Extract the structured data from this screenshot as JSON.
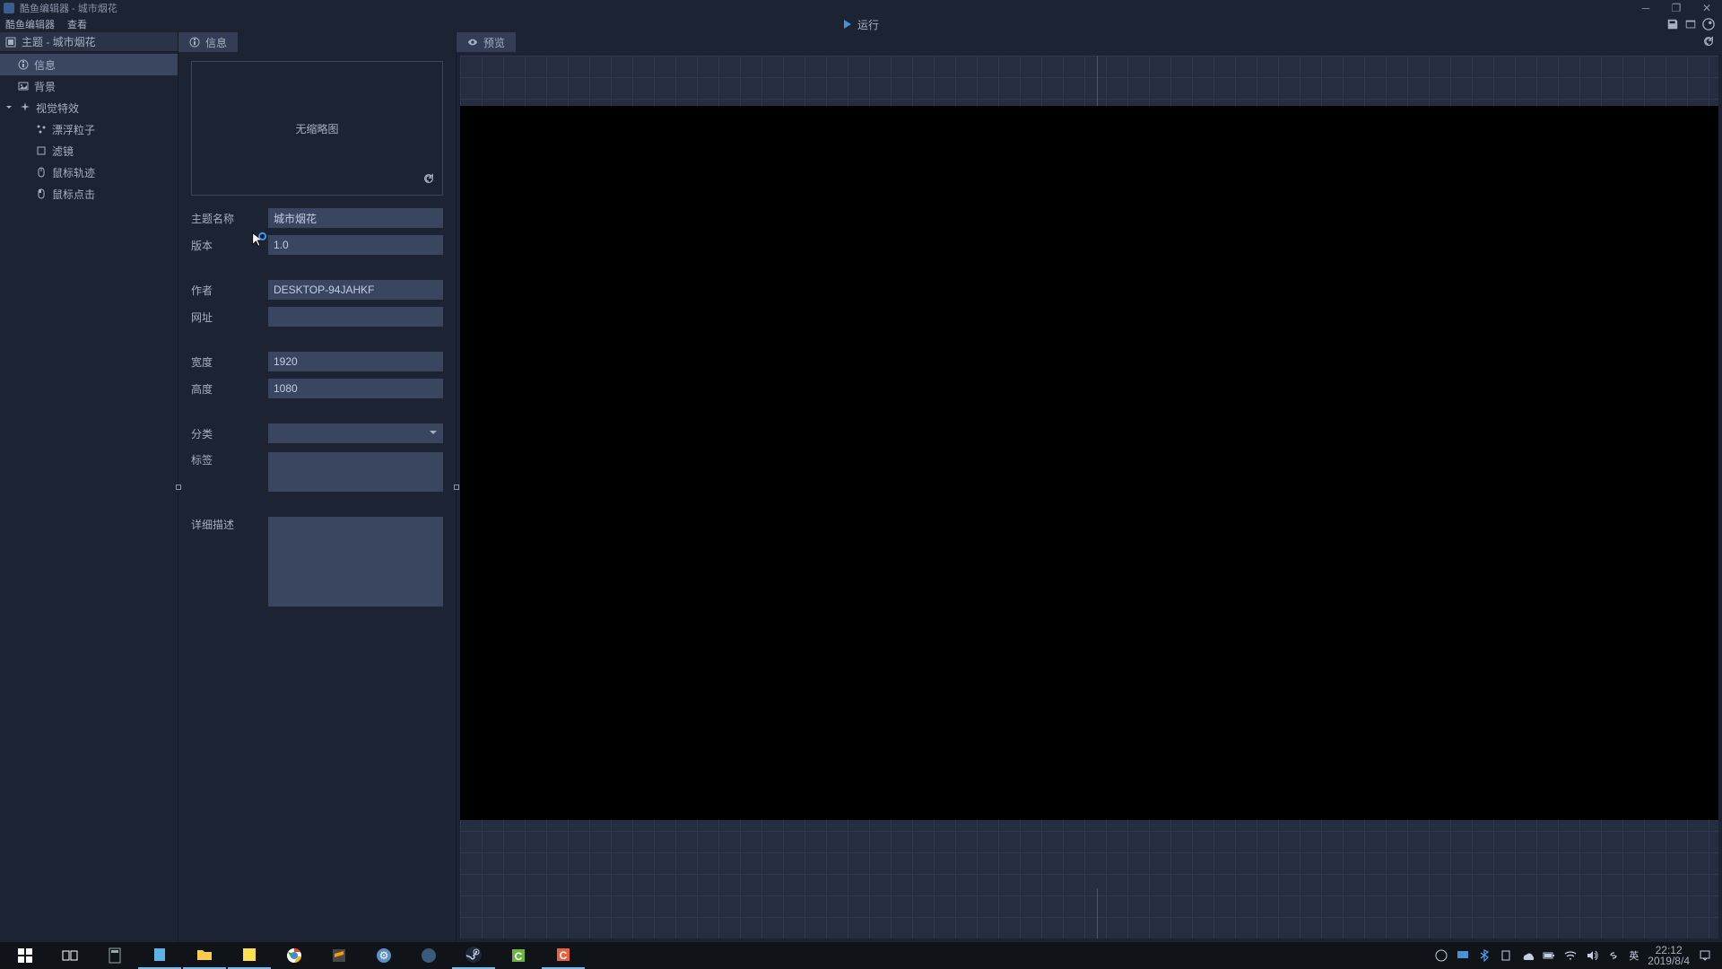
{
  "window": {
    "title": "酷鱼编辑器 - 城市烟花"
  },
  "menu": {
    "editor": "酷鱼编辑器",
    "view": "查看",
    "run": "运行"
  },
  "sidebar": {
    "header": "主题 - 城市烟花",
    "items": [
      {
        "label": "信息"
      },
      {
        "label": "背景"
      },
      {
        "label": "视觉特效"
      },
      {
        "label": "漂浮粒子"
      },
      {
        "label": "滤镜"
      },
      {
        "label": "鼠标轨迹"
      },
      {
        "label": "鼠标点击"
      }
    ]
  },
  "infoTab": {
    "label": "信息"
  },
  "previewTab": {
    "label": "预览"
  },
  "thumbnail": {
    "placeholder": "无缩略图"
  },
  "form": {
    "name_label": "主题名称",
    "name_value": "城市烟花",
    "version_label": "版本",
    "version_value": "1.0",
    "author_label": "作者",
    "author_value": "DESKTOP-94JAHKF",
    "url_label": "网址",
    "url_value": "",
    "width_label": "宽度",
    "width_value": "1920",
    "height_label": "高度",
    "height_value": "1080",
    "category_label": "分类",
    "category_value": "",
    "tags_label": "标签",
    "tags_value": "",
    "desc_label": "详细描述",
    "desc_value": ""
  },
  "tray": {
    "ime": "英",
    "time": "22:12",
    "date": "2019/8/4"
  }
}
